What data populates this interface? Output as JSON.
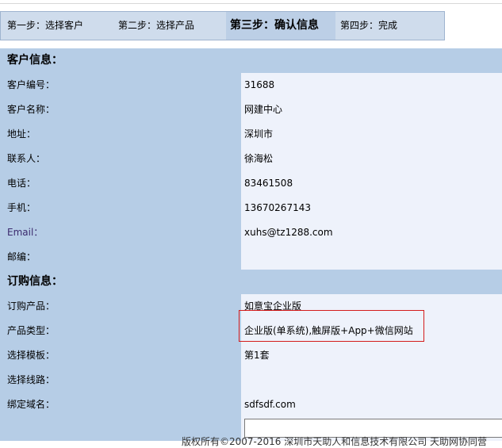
{
  "steps": {
    "step1": "第一步：选择客户",
    "step2": "第二步：选择产品",
    "step3": "第三步：确认信息",
    "step4": "第四步：完成"
  },
  "customer_section": {
    "title": "客户信息：",
    "rows": [
      {
        "label": "客户编号：",
        "value": "31688"
      },
      {
        "label": "客户名称：",
        "value": "网建中心"
      },
      {
        "label": "地址：",
        "value": "深圳市"
      },
      {
        "label": "联系人：",
        "value": "徐海松"
      },
      {
        "label": "电话：",
        "value": "83461508"
      },
      {
        "label": "手机：",
        "value": "13670267143"
      },
      {
        "label": "Email：",
        "value": "xuhs@tz1288.com"
      },
      {
        "label": "邮编：",
        "value": ""
      }
    ]
  },
  "order_section": {
    "title": "订购信息：",
    "rows": [
      {
        "label": "订购产品：",
        "value": "如意宝企业版"
      },
      {
        "label": "产品类型：",
        "value": "企业版(单系统),触屏版+App+微信网站"
      },
      {
        "label": "选择模板：",
        "value": "第1套"
      },
      {
        "label": "选择线路：",
        "value": ""
      },
      {
        "label": "绑定域名：",
        "value": "sdfsdf.com"
      }
    ]
  },
  "footer": {
    "text": "版权所有©2007-2016 深圳市天助人和信息技术有限公司 天助网协同营"
  },
  "colors": {
    "label_bg": "#b6cde6",
    "value_bg": "#eef2fb",
    "step_bar_bg": "#cfdcec",
    "highlight_border": "#d41c1c"
  }
}
